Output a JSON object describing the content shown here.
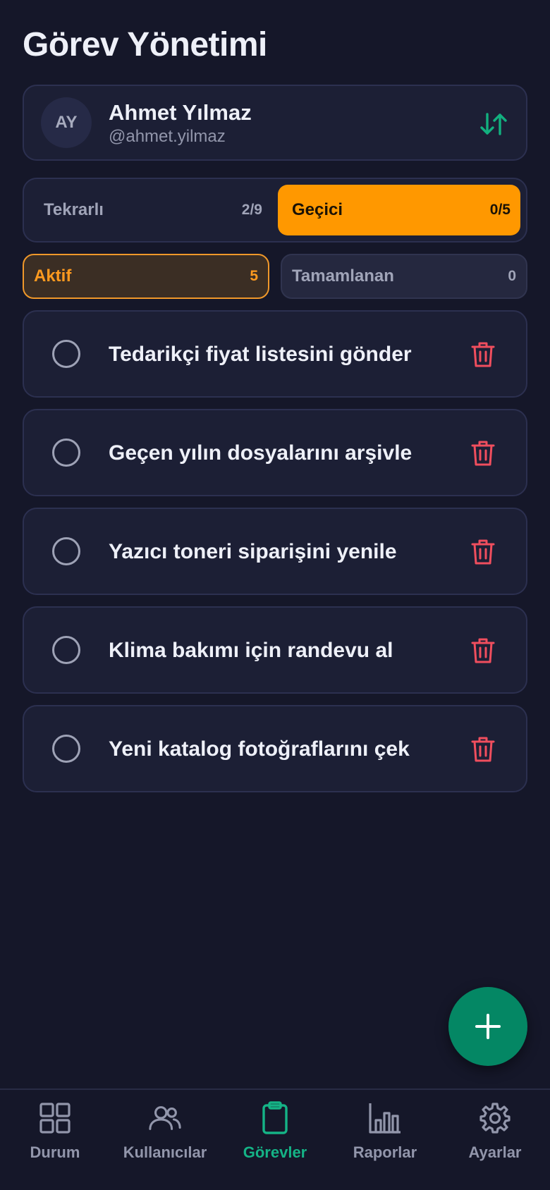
{
  "app": {
    "title": "Görev Yönetimi"
  },
  "user": {
    "initials": "AY",
    "name": "Ahmet Yılmaz",
    "handle": "@ahmet.yilmaz"
  },
  "type_toggle": {
    "options": [
      {
        "label": "Tekrarlı",
        "count": "2/9",
        "selected": false
      },
      {
        "label": "Geçici",
        "count": "0/5",
        "selected": true
      }
    ]
  },
  "status_tabs": [
    {
      "label": "Aktif",
      "count": "5",
      "selected": true
    },
    {
      "label": "Tamamlanan",
      "count": "0",
      "selected": false
    }
  ],
  "tasks": [
    {
      "text": "Tedarikçi fiyat listesini gönder",
      "done": false
    },
    {
      "text": "Geçen yılın dosyalarını arşivle",
      "done": false
    },
    {
      "text": "Yazıcı toneri siparişini yenile",
      "done": false
    },
    {
      "text": "Klima bakımı için randevu al",
      "done": false
    },
    {
      "text": "Yeni katalog fotoğraflarını çek",
      "done": false
    }
  ],
  "bottom_nav": {
    "items": [
      {
        "label": "Durum",
        "icon": "grid-icon",
        "active": false
      },
      {
        "label": "Kullanıcılar",
        "icon": "users-icon",
        "active": false
      },
      {
        "label": "Görevler",
        "icon": "clipboard-icon",
        "active": true
      },
      {
        "label": "Raporlar",
        "icon": "bar-chart-icon",
        "active": false
      },
      {
        "label": "Ayarlar",
        "icon": "gear-icon",
        "active": false
      }
    ]
  },
  "colors": {
    "background": "#151729",
    "card": "#1c1f35",
    "accent_orange": "#ff9800",
    "accent_green": "#15b386",
    "fab": "#048764",
    "danger": "#f04e5e"
  }
}
